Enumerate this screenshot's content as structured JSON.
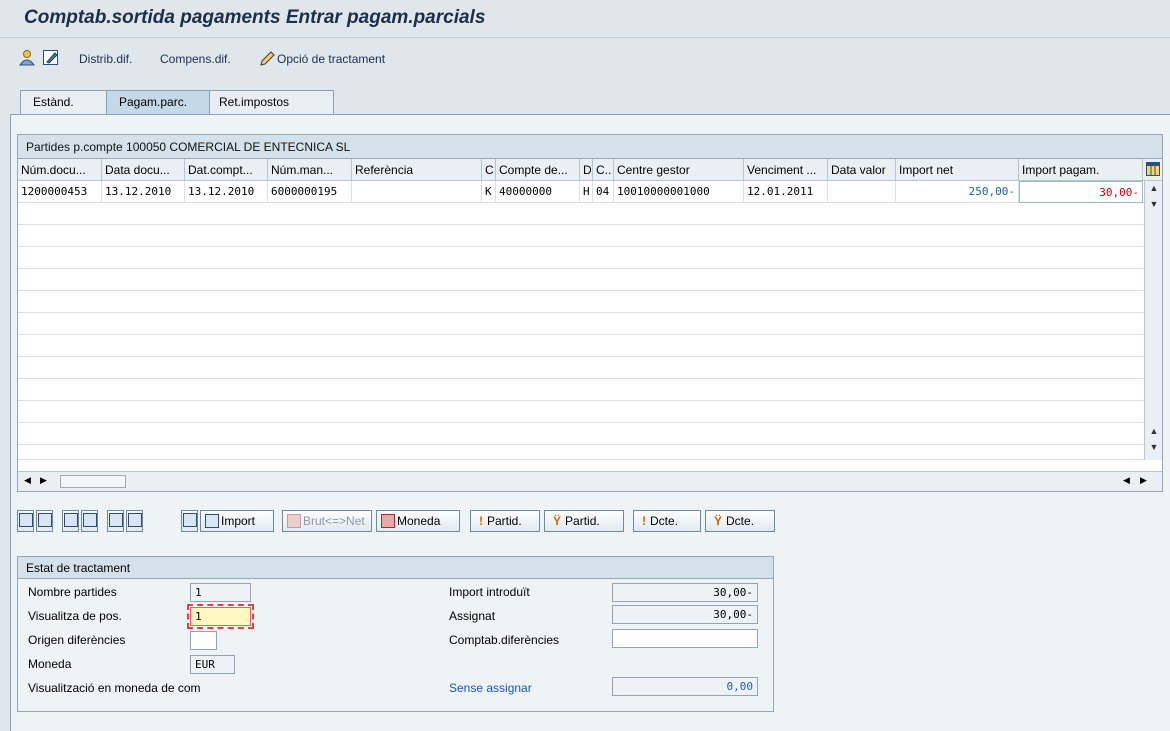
{
  "title": "Comptab.sortida pagaments Entrar pagam.parcials",
  "app_toolbar": {
    "distrib_dif": "Distrib.dif.",
    "compens_dif": "Compens.dif.",
    "opcio_tractament": "Opció de tractament"
  },
  "tabs": [
    "Estànd.",
    "Pagam.parc.",
    "Ret.impostos"
  ],
  "grid": {
    "title": "Partides p.compte 100050 COMERCIAL DE ENTECNICA SL",
    "columns": [
      "Núm.docu...",
      "Data docu...",
      "Dat.compt...",
      "Núm.man...",
      "Referència",
      "C",
      "Compte de...",
      "D",
      "C..",
      "Centre gestor",
      "Venciment ...",
      "Data valor",
      "Import net",
      "Import pagam."
    ],
    "rows": [
      [
        "1200000453",
        "13.12.2010",
        "13.12.2010",
        "6000000195",
        "",
        "K",
        "40000000",
        "H",
        "04",
        "10010000001000",
        "12.01.2011",
        "",
        "250,00-",
        "30,00-"
      ]
    ]
  },
  "grid_buttons": {
    "import": "Import",
    "brut_net": "Brut<=>Net",
    "moneda": "Moneda",
    "partid_1": "Partid.",
    "partid_2": "Partid.",
    "dcte_1": "Dcte.",
    "dcte_2": "Dcte."
  },
  "status": {
    "title": "Estat de tractament",
    "nombre_partides_label": "Nombre partides",
    "nombre_partides_value": "1",
    "visualitza_pos_label": "Visualitza de pos.",
    "visualitza_pos_value": "1",
    "origen_label": "Origen diferències",
    "origen_value": "",
    "moneda_label": "Moneda",
    "moneda_value": "EUR",
    "moneda_com_label": "Visualització en moneda de com",
    "import_introduit_label": "Import introduït",
    "import_introduit_value": "30,00-",
    "assignat_label": "Assignat",
    "assignat_value": "30,00-",
    "comptab_dif_label": "Comptab.diferències",
    "comptab_dif_value": "",
    "sense_assignar_label": "Sense assignar",
    "sense_assignar_value": "0,00"
  },
  "colors": {
    "link": "#1a54b6",
    "amount_blue": "#1c5fa3",
    "amount_red": "#c00000"
  }
}
